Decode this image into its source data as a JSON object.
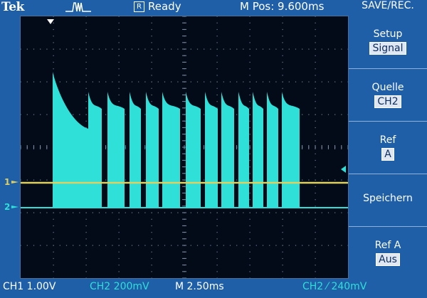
{
  "header": {
    "brand": "Tek",
    "acq_icon_glyph": "R",
    "acq_status": "Ready",
    "m_pos": "M Pos: 9.600ms",
    "menu_title": "SAVE/REC."
  },
  "menu": [
    {
      "label": "Setup",
      "value": "Signal"
    },
    {
      "label": "Quelle",
      "value": "CH2"
    },
    {
      "label": "Ref",
      "value": "A"
    },
    {
      "label": "Speichern",
      "value": ""
    },
    {
      "label": "Ref A",
      "value": "Aus"
    }
  ],
  "footer": {
    "ch1": "CH1  1.00V",
    "ch2": "CH2  200mV",
    "timebase": "M 2.50ms",
    "trigger": "CH2 ⁄ 240mV"
  },
  "markers": {
    "ch1": "1",
    "ch2": "2"
  },
  "colors": {
    "ch1": "#e0d060",
    "ch2": "#2ee0d8",
    "frame": "#1f5fa8"
  }
}
